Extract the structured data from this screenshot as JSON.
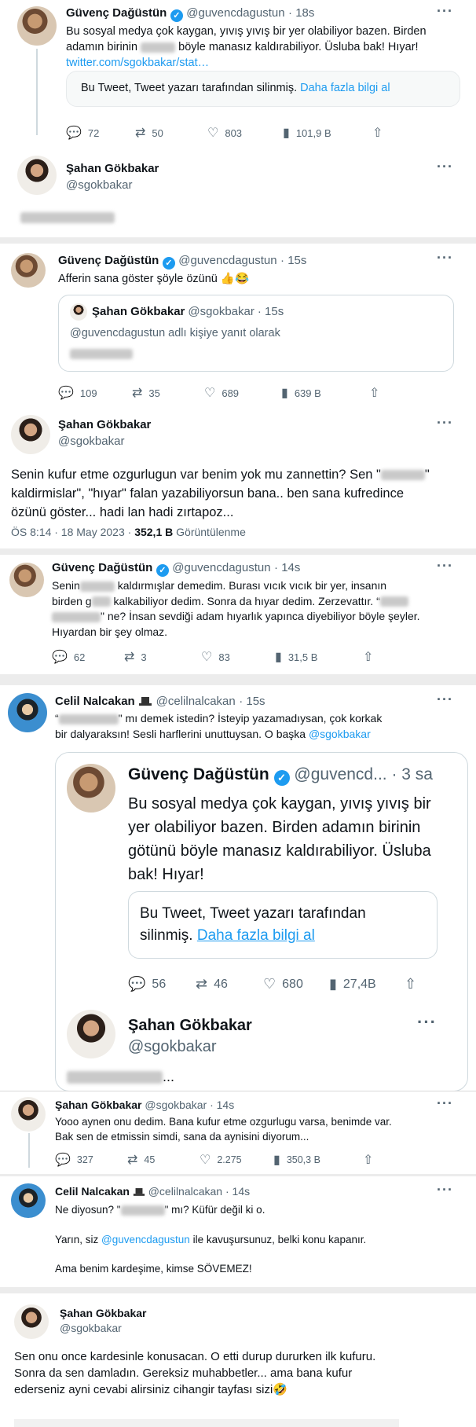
{
  "icons": {
    "reply": "reply-icon",
    "retweet": "retweet-icon",
    "like": "like-icon",
    "views": "views-icon",
    "share": "share-icon",
    "more": "more-icon",
    "verified": "verified-icon"
  },
  "colors": {
    "link": "#1d9bf0",
    "muted": "#536471",
    "text": "#0f1419",
    "border": "#cfd9de"
  },
  "s1": {
    "name": "Güvenç Dağüstün",
    "handle": "@guvencdagustun",
    "time": "· 18s",
    "text1": "Bu sosyal medya çok kaygan, yıvış yıvış bir yer olabiliyor bazen. Birden adamın birinin",
    "text2": "böyle manasız kaldırabiliyor. Üsluba bak! Hıyar!",
    "link": "twitter.com/sgokbakar/stat…",
    "deleted": "Bu Tweet, Tweet yazarı tarafından silinmiş.",
    "learn": "Daha fazla bilgi al",
    "replies": "72",
    "retweets": "50",
    "likes": "803",
    "views": "101,9 B",
    "sahan_name": "Şahan Gökbakar",
    "sahan_handle": "@sgokbakar"
  },
  "s2": {
    "name": "Güvenç Dağüstün",
    "handle": "@guvencdagustun",
    "time": "· 15s",
    "text": "Afferin sana göster şöyle özünü 👍😂",
    "q_name": "Şahan Gökbakar",
    "q_handle": "@sgokbakar",
    "q_time": "· 15s",
    "q_reply": "@guvencdagustun adlı kişiye yanıt olarak",
    "replies": "109",
    "retweets": "35",
    "likes": "689",
    "views": "639 B"
  },
  "s3": {
    "name": "Şahan Gökbakar",
    "handle": "@sgokbakar",
    "t1a": "Senin kufur etme ozgurlugun var benim yok mu zannettin? Sen \"",
    "t1b": "\"",
    "t2": "kaldirmislar\", \"hıyar\" falan yazabiliyorsun bana.. ben sana kufredince",
    "t3": "özünü göster... hadi lan hadi zırtapoz...",
    "meta_time": "ÖS 8:14 · 18 May 2023 ·",
    "meta_views": "352,1 B",
    "meta_label": "Görüntülenme"
  },
  "s4": {
    "name": "Güvenç Dağüstün",
    "handle": "@guvencdagustun",
    "time": "· 14s",
    "t1a": "Senin",
    "t1b": "kaldırmışlar demedim. Burası vıcık vıcık bir yer, insanın",
    "t2a": "birden g",
    "t2b": "kalkabiliyor dedim. Sonra da hıyar dedim. Zerzevattır. “",
    "t3a": "\" ne? İnsan sevdiği adam hıyarlık yapınca diyebiliyor böyle şeyler.",
    "t4": "Hıyardan bir şey olmaz.",
    "replies": "62",
    "retweets": "3",
    "likes": "83",
    "views": "31,5 B"
  },
  "s5": {
    "name": "Celil Nalcakan",
    "handle": "@celilnalcakan",
    "time": "· 15s",
    "t1b": "\" mı demek istedin? İsteyip yazamadıysan, çok korkak",
    "t2": "bir dalyaraksın! Sesli harflerini unuttuysan. O başka",
    "t2link": "@sgokbakar",
    "q_name": "Güvenç Dağüstün",
    "q_handle": "@guvencd...",
    "q_time": "· 3 sa",
    "q_t1": "Bu sosyal medya çok kaygan, yıvış yıvış bir",
    "q_t2": "yer olabiliyor bazen. Birden adamın birinin",
    "q_t3": "götünü böyle manasız kaldırabiliyor. Üsluba",
    "q_t4": "bak! Hıyar!",
    "q_del1": "Bu Tweet, Tweet yazarı tarafından",
    "q_del2": "silinmiş.",
    "q_learn": "Daha fazla bilgi al",
    "q_replies": "56",
    "q_retweets": "46",
    "q_likes": "680",
    "q_views": "27,4B",
    "q_sahan_name": "Şahan Gökbakar",
    "q_sahan_handle": "@sgokbakar",
    "q_blur_suffix": "..."
  },
  "s6": {
    "name": "Şahan Gökbakar",
    "handle": "@sgokbakar",
    "time": "· 14s",
    "t1": "Yooo aynen onu dedim. Bana kufur etme ozgurlugu varsa, benimde var.",
    "t2": "Bak sen de etmissin simdi, sana da aynisini diyorum...",
    "replies": "327",
    "retweets": "45",
    "likes": "2.275",
    "views": "350,3 B"
  },
  "s7": {
    "name": "Celil Nalcakan",
    "handle": "@celilnalcakan",
    "time": "· 14s",
    "t1a": "Ne diyosun? \"",
    "t1b": "\" mı? Küfür değil ki o.",
    "t2a": "Yarın, siz",
    "t2link": "@guvencdagustun",
    "t2b": "ile kavuşursunuz, belki konu kapanır.",
    "t3": "Ama benim kardeşime, kimse SÖVEMEZ!"
  },
  "s8": {
    "name": "Şahan Gökbakar",
    "handle": "@sgokbakar",
    "t1": "Sen onu once kardesinle konusacan. O etti durup dururken ilk kufuru.",
    "t2": "Sonra da sen damladın. Gereksiz muhabbetler... ama bana kufur",
    "t3": "ederseniz ayni cevabi alirsiniz cihangir tayfası sizi🤣"
  }
}
